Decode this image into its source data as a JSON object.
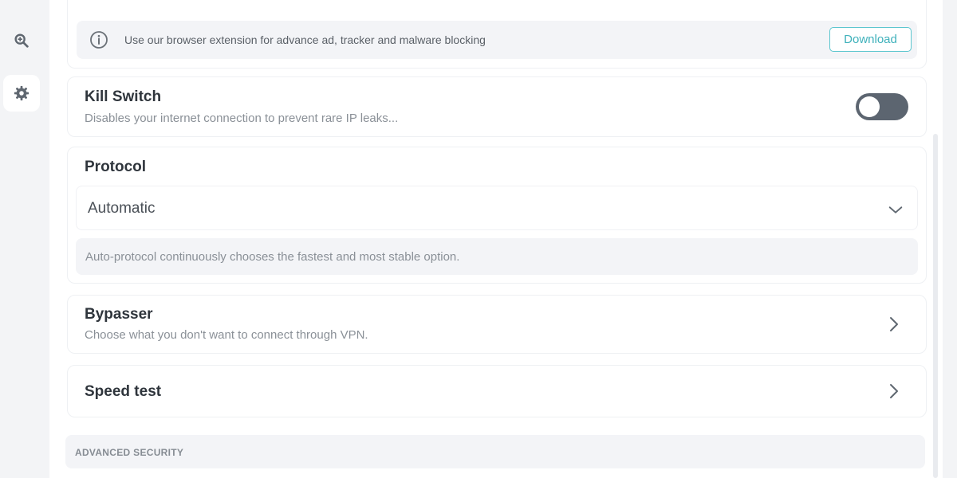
{
  "sidebar": {
    "items": [
      {
        "icon": "search-icon"
      },
      {
        "icon": "gear-icon",
        "active": true
      }
    ]
  },
  "notice": {
    "text": "Use our browser extension for advance ad, tracker and malware blocking",
    "button_label": "Download",
    "icon": "info-icon",
    "accent_color": "#3fb1bb"
  },
  "kill_switch": {
    "title": "Kill Switch",
    "description": "Disables your internet connection to prevent rare IP leaks...",
    "enabled": false
  },
  "protocol": {
    "title": "Protocol",
    "selected": "Automatic",
    "hint": "Auto-protocol continuously chooses the fastest and most stable option."
  },
  "bypasser": {
    "title": "Bypasser",
    "description": "Choose what you don't want to connect through VPN."
  },
  "speed_test": {
    "title": "Speed test"
  },
  "sections": {
    "advanced_security": "ADVANCED SECURITY"
  }
}
